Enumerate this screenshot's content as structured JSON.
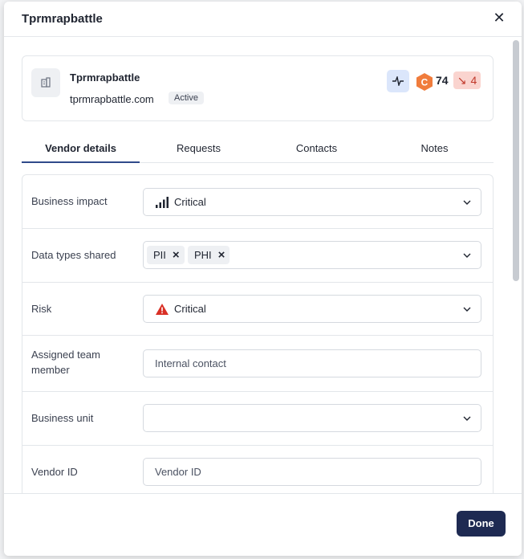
{
  "modal": {
    "title": "Tprmrapbattle"
  },
  "vendor": {
    "name": "Tprmrapbattle",
    "domain": "tprmrapbattle.com",
    "status": "Active",
    "grade": "C",
    "score": "74",
    "trend": "4"
  },
  "tabs": [
    {
      "label": "Vendor details",
      "active": true
    },
    {
      "label": "Requests",
      "active": false
    },
    {
      "label": "Contacts",
      "active": false
    },
    {
      "label": "Notes",
      "active": false
    }
  ],
  "form": {
    "business_impact": {
      "label": "Business impact",
      "value": "Critical",
      "icon": "signal-bars-icon"
    },
    "data_types": {
      "label": "Data types shared",
      "tags": [
        "PII",
        "PHI"
      ]
    },
    "risk": {
      "label": "Risk",
      "value": "Critical",
      "icon": "warning-triangle-icon"
    },
    "assigned": {
      "label": "Assigned team member",
      "placeholder": "Internal contact"
    },
    "business_unit": {
      "label": "Business unit",
      "value": ""
    },
    "vendor_id": {
      "label": "Vendor ID",
      "placeholder": "Vendor ID"
    }
  },
  "footer": {
    "done_label": "Done"
  },
  "colors": {
    "primary": "#1e2a52",
    "accent": "#2f4a8a",
    "risk": "#d93025",
    "grade": "#f07c3c",
    "trend_bg": "#fad4cf"
  }
}
